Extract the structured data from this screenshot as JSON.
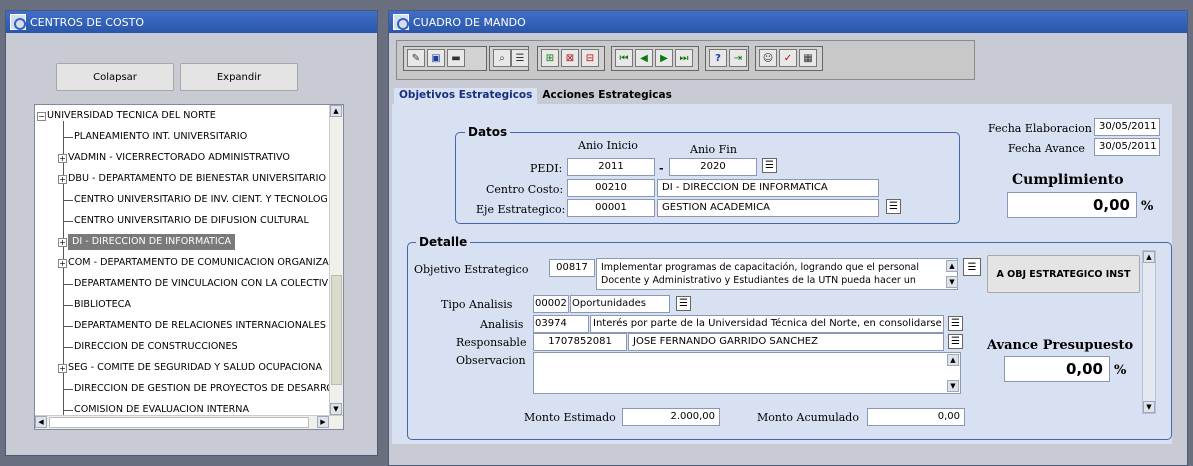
{
  "left_window": {
    "title": "CENTROS DE COSTO",
    "collapse_label": "Colapsar",
    "expand_label": "Expandir",
    "tree": {
      "root": "UNIVERSIDAD TECNICA DEL NORTE",
      "items": [
        "PLANEAMIENTO INT. UNIVERSITARIO",
        "VADMIN - VICERRECTORADO ADMINISTRATIVO",
        "DBU - DEPARTAMENTO DE BIENESTAR UNIVERSITARIO",
        "CENTRO UNIVERSITARIO DE INV. CIENT. Y TECNOLOG",
        "CENTRO UNIVERSITARIO DE DIFUSION CULTURAL",
        "DI - DIRECCION DE INFORMATICA",
        "COM - DEPARTAMENTO DE COMUNICACION ORGANIZA",
        "DEPARTAMENTO DE VINCULACION CON LA COLECTIV",
        "BIBLIOTECA",
        "DEPARTAMENTO DE RELACIONES INTERNACIONALES",
        "DIRECCION DE CONSTRUCCIONES",
        "SEG - COMITE DE SEGURIDAD Y SALUD OCUPACIONA",
        "DIRECCION DE GESTION DE PROYECTOS DE DESARRC",
        "COMISION DE EVALUACION INTERNA"
      ]
    }
  },
  "right_window": {
    "title": "CUADRO DE MANDO",
    "tabs": [
      "Objetivos Estrategicos",
      "Acciones Estrategicas"
    ],
    "fecha_elaboracion_label": "Fecha Elaboracion",
    "fecha_elaboracion": "30/05/2011",
    "fecha_avance_label": "Fecha Avance",
    "fecha_avance": "30/05/2011",
    "cumplimiento_label": "Cumplimiento",
    "cumplimiento_value": "0,00",
    "percent": "%",
    "datos": {
      "title": "Datos",
      "anio_inicio_label": "Anio Inicio",
      "anio_fin_label": "Anio Fin",
      "pedi_label": "PEDI:",
      "anio_inicio": "2011",
      "dash": "-",
      "anio_fin": "2020",
      "centro_costo_label": "Centro Costo:",
      "centro_costo_code": "00210",
      "centro_costo_name": "DI - DIRECCION DE INFORMATICA",
      "eje_label": "Eje Estrategico:",
      "eje_code": "00001",
      "eje_name": "GESTION ACADEMICA"
    },
    "detalle": {
      "title": "Detalle",
      "objetivo_label": "Objetivo Estrategico",
      "objetivo_code": "00817",
      "objetivo_text_1": "Implementar programas de capacitación, logrando que el personal",
      "objetivo_text_2": "Docente y Administrativo y Estudiantes de la UTN pueda hacer un",
      "a_obj_button": "A OBJ ESTRATEGICO INST",
      "tipo_label": "Tipo Analisis",
      "tipo_code": "00002",
      "tipo_name": "Oportunidades",
      "analisis_label": "Analisis",
      "analisis_code": "03974",
      "analisis_text": "Interés por parte de la Universidad Técnica del Norte, en consolidarse c",
      "responsable_label": "Responsable",
      "responsable_id": "1707852081",
      "responsable_name": "JOSE FERNANDO GARRIDO SANCHEZ",
      "observacion_label": "Observacion",
      "observacion_value": "",
      "avance_label": "Avance Presupuesto",
      "avance_value": "0,00",
      "monto_estimado_label": "Monto Estimado",
      "monto_estimado": "2.000,00",
      "monto_acumulado_label": "Monto Acumulado",
      "monto_acumulado": "0,00"
    }
  }
}
